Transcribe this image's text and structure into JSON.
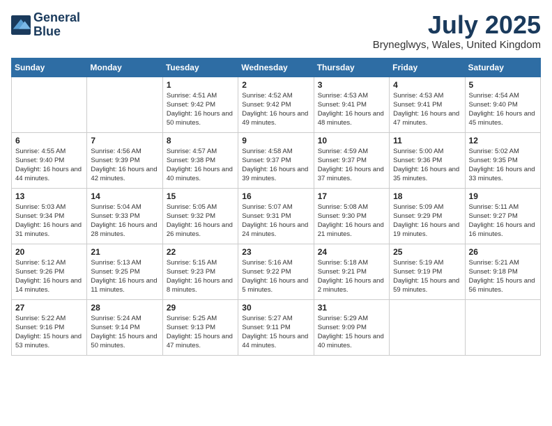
{
  "header": {
    "logo_line1": "General",
    "logo_line2": "Blue",
    "month_year": "July 2025",
    "location": "Bryneglwys, Wales, United Kingdom"
  },
  "weekdays": [
    "Sunday",
    "Monday",
    "Tuesday",
    "Wednesday",
    "Thursday",
    "Friday",
    "Saturday"
  ],
  "weeks": [
    [
      {
        "day": "",
        "empty": true
      },
      {
        "day": "",
        "empty": true
      },
      {
        "day": "1",
        "sunrise": "4:51 AM",
        "sunset": "9:42 PM",
        "daylight": "16 hours and 50 minutes."
      },
      {
        "day": "2",
        "sunrise": "4:52 AM",
        "sunset": "9:42 PM",
        "daylight": "16 hours and 49 minutes."
      },
      {
        "day": "3",
        "sunrise": "4:53 AM",
        "sunset": "9:41 PM",
        "daylight": "16 hours and 48 minutes."
      },
      {
        "day": "4",
        "sunrise": "4:53 AM",
        "sunset": "9:41 PM",
        "daylight": "16 hours and 47 minutes."
      },
      {
        "day": "5",
        "sunrise": "4:54 AM",
        "sunset": "9:40 PM",
        "daylight": "16 hours and 45 minutes."
      }
    ],
    [
      {
        "day": "6",
        "sunrise": "4:55 AM",
        "sunset": "9:40 PM",
        "daylight": "16 hours and 44 minutes."
      },
      {
        "day": "7",
        "sunrise": "4:56 AM",
        "sunset": "9:39 PM",
        "daylight": "16 hours and 42 minutes."
      },
      {
        "day": "8",
        "sunrise": "4:57 AM",
        "sunset": "9:38 PM",
        "daylight": "16 hours and 40 minutes."
      },
      {
        "day": "9",
        "sunrise": "4:58 AM",
        "sunset": "9:37 PM",
        "daylight": "16 hours and 39 minutes."
      },
      {
        "day": "10",
        "sunrise": "4:59 AM",
        "sunset": "9:37 PM",
        "daylight": "16 hours and 37 minutes."
      },
      {
        "day": "11",
        "sunrise": "5:00 AM",
        "sunset": "9:36 PM",
        "daylight": "16 hours and 35 minutes."
      },
      {
        "day": "12",
        "sunrise": "5:02 AM",
        "sunset": "9:35 PM",
        "daylight": "16 hours and 33 minutes."
      }
    ],
    [
      {
        "day": "13",
        "sunrise": "5:03 AM",
        "sunset": "9:34 PM",
        "daylight": "16 hours and 31 minutes."
      },
      {
        "day": "14",
        "sunrise": "5:04 AM",
        "sunset": "9:33 PM",
        "daylight": "16 hours and 28 minutes."
      },
      {
        "day": "15",
        "sunrise": "5:05 AM",
        "sunset": "9:32 PM",
        "daylight": "16 hours and 26 minutes."
      },
      {
        "day": "16",
        "sunrise": "5:07 AM",
        "sunset": "9:31 PM",
        "daylight": "16 hours and 24 minutes."
      },
      {
        "day": "17",
        "sunrise": "5:08 AM",
        "sunset": "9:30 PM",
        "daylight": "16 hours and 21 minutes."
      },
      {
        "day": "18",
        "sunrise": "5:09 AM",
        "sunset": "9:29 PM",
        "daylight": "16 hours and 19 minutes."
      },
      {
        "day": "19",
        "sunrise": "5:11 AM",
        "sunset": "9:27 PM",
        "daylight": "16 hours and 16 minutes."
      }
    ],
    [
      {
        "day": "20",
        "sunrise": "5:12 AM",
        "sunset": "9:26 PM",
        "daylight": "16 hours and 14 minutes."
      },
      {
        "day": "21",
        "sunrise": "5:13 AM",
        "sunset": "9:25 PM",
        "daylight": "16 hours and 11 minutes."
      },
      {
        "day": "22",
        "sunrise": "5:15 AM",
        "sunset": "9:23 PM",
        "daylight": "16 hours and 8 minutes."
      },
      {
        "day": "23",
        "sunrise": "5:16 AM",
        "sunset": "9:22 PM",
        "daylight": "16 hours and 5 minutes."
      },
      {
        "day": "24",
        "sunrise": "5:18 AM",
        "sunset": "9:21 PM",
        "daylight": "16 hours and 2 minutes."
      },
      {
        "day": "25",
        "sunrise": "5:19 AM",
        "sunset": "9:19 PM",
        "daylight": "15 hours and 59 minutes."
      },
      {
        "day": "26",
        "sunrise": "5:21 AM",
        "sunset": "9:18 PM",
        "daylight": "15 hours and 56 minutes."
      }
    ],
    [
      {
        "day": "27",
        "sunrise": "5:22 AM",
        "sunset": "9:16 PM",
        "daylight": "15 hours and 53 minutes."
      },
      {
        "day": "28",
        "sunrise": "5:24 AM",
        "sunset": "9:14 PM",
        "daylight": "15 hours and 50 minutes."
      },
      {
        "day": "29",
        "sunrise": "5:25 AM",
        "sunset": "9:13 PM",
        "daylight": "15 hours and 47 minutes."
      },
      {
        "day": "30",
        "sunrise": "5:27 AM",
        "sunset": "9:11 PM",
        "daylight": "15 hours and 44 minutes."
      },
      {
        "day": "31",
        "sunrise": "5:29 AM",
        "sunset": "9:09 PM",
        "daylight": "15 hours and 40 minutes."
      },
      {
        "day": "",
        "empty": true
      },
      {
        "day": "",
        "empty": true
      }
    ]
  ]
}
